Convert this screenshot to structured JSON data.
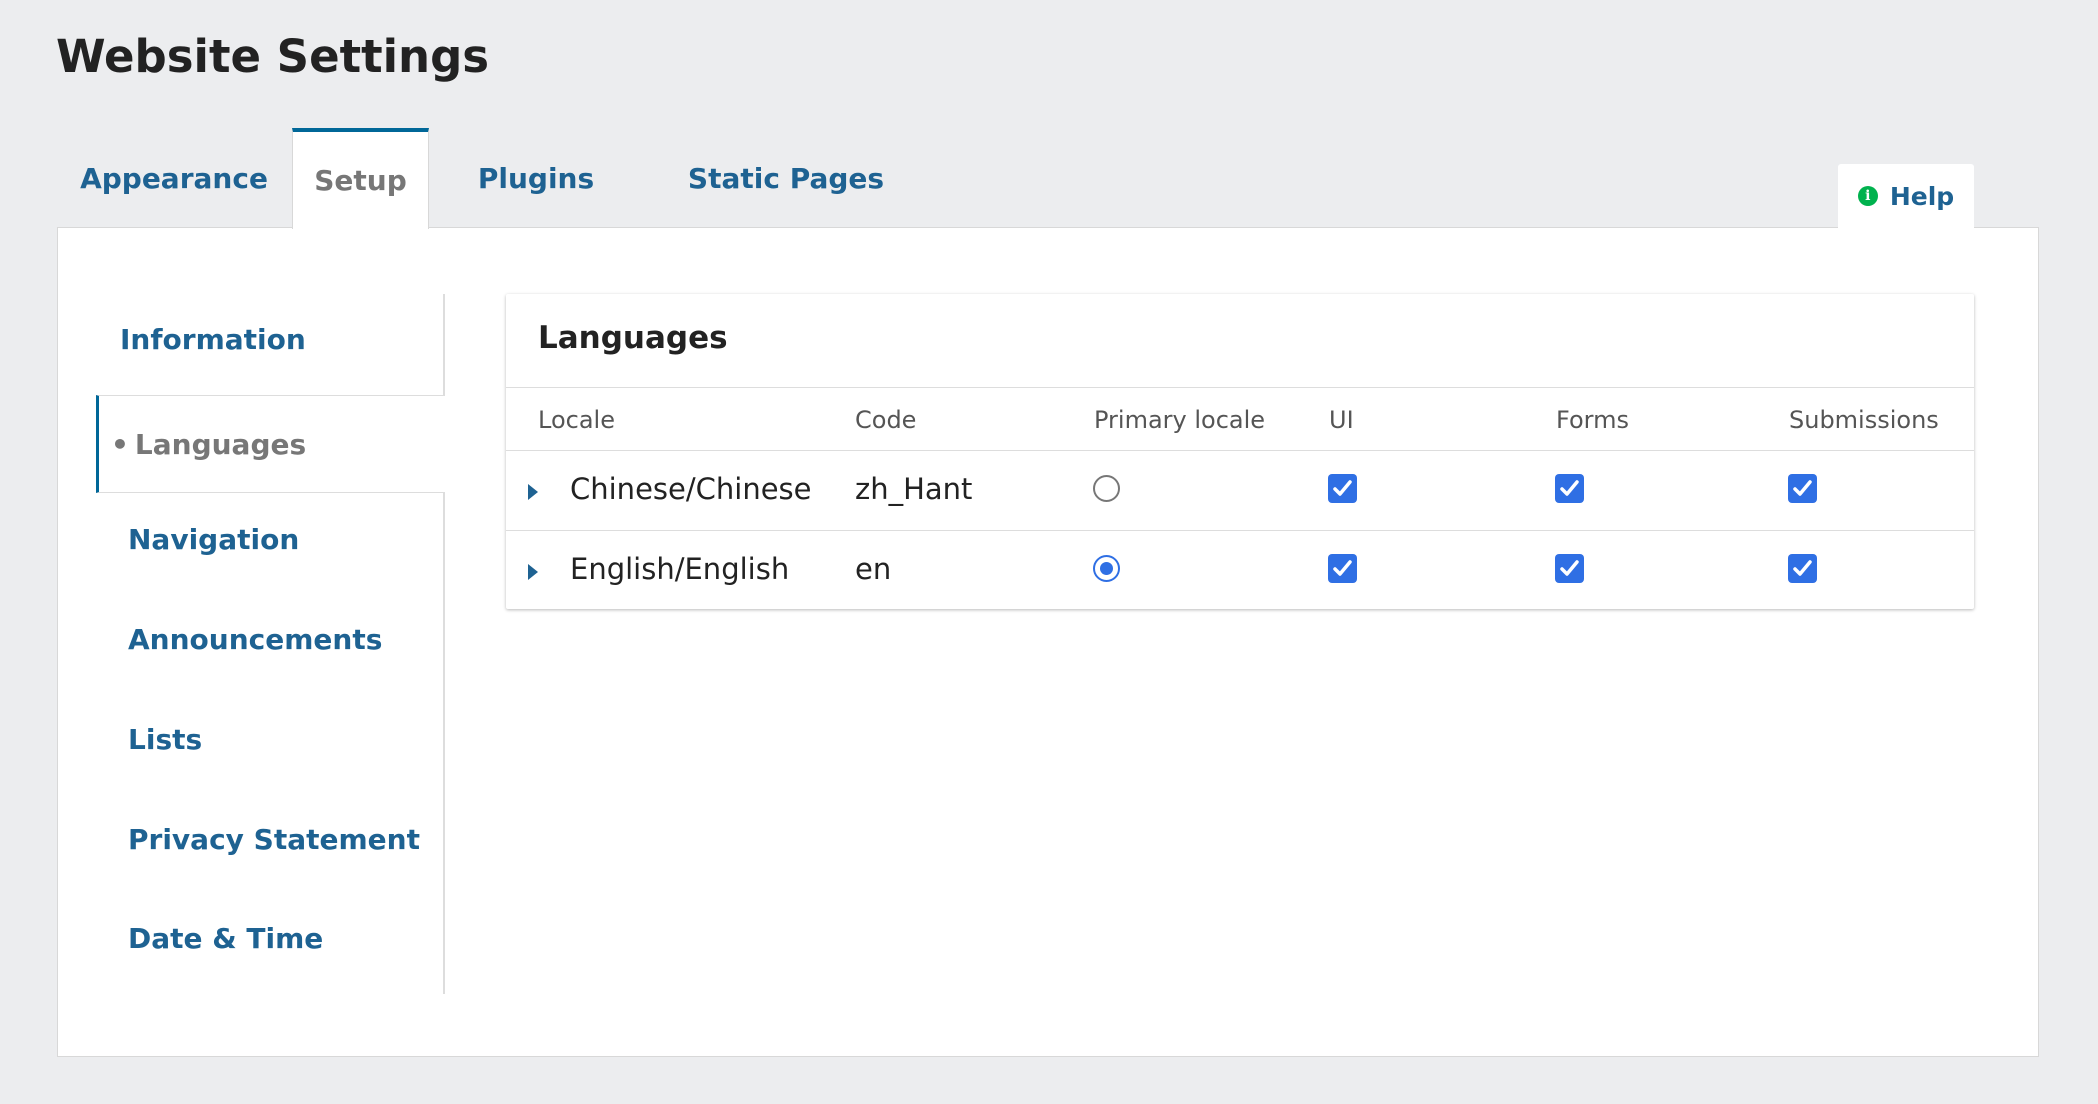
{
  "page": {
    "title": "Website Settings"
  },
  "tabs": [
    {
      "label": "Appearance"
    },
    {
      "label": "Setup"
    },
    {
      "label": "Plugins"
    },
    {
      "label": "Static Pages"
    }
  ],
  "help": {
    "label": "Help",
    "icon": "info-icon"
  },
  "side_nav": [
    {
      "label": "Information"
    },
    {
      "label": "Languages",
      "bullet": "•"
    },
    {
      "label": "Navigation"
    },
    {
      "label": "Announcements"
    },
    {
      "label": "Lists"
    },
    {
      "label": "Privacy Statement"
    },
    {
      "label": "Date & Time"
    }
  ],
  "languages": {
    "title": "Languages",
    "columns": [
      "Locale",
      "Code",
      "Primary locale",
      "UI",
      "Forms",
      "Submissions"
    ],
    "rows": [
      {
        "locale": "Chinese/Chinese",
        "code": "zh_Hant",
        "primary": false,
        "ui": true,
        "forms": true,
        "submissions": true
      },
      {
        "locale": "English/English",
        "code": "en",
        "primary": true,
        "ui": true,
        "forms": true,
        "submissions": true
      }
    ]
  },
  "colors": {
    "accent": "#006798",
    "link": "#1e6292",
    "checkbox": "#2f6fe4",
    "background": "#ecedef"
  }
}
